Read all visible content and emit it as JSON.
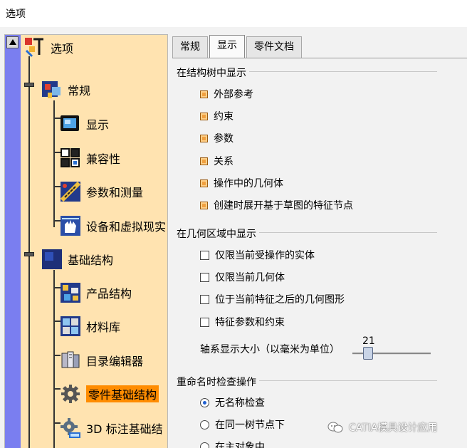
{
  "window": {
    "title": "选项"
  },
  "tree": {
    "items": [
      {
        "label": "选项",
        "icon": "options-icon"
      },
      {
        "label": "常规",
        "icon": "general-icon"
      },
      {
        "label": "显示",
        "icon": "display-icon"
      },
      {
        "label": "兼容性",
        "icon": "compatibility-icon"
      },
      {
        "label": "参数和测量",
        "icon": "parameters-measure-icon"
      },
      {
        "label": "设备和虚拟现实",
        "icon": "devices-vr-icon"
      },
      {
        "label": "基础结构",
        "icon": "infrastructure-icon"
      },
      {
        "label": "产品结构",
        "icon": "product-structure-icon"
      },
      {
        "label": "材料库",
        "icon": "material-library-icon"
      },
      {
        "label": "目录编辑器",
        "icon": "catalog-editor-icon"
      },
      {
        "label": "零件基础结构",
        "icon": "part-infrastructure-gear-icon",
        "selected": true
      },
      {
        "label": "3D 标注基础结",
        "icon": "annotation-3d-gear-icon"
      }
    ]
  },
  "tabs": [
    {
      "label": "常规",
      "active": false
    },
    {
      "label": "显示",
      "active": true
    },
    {
      "label": "零件文档",
      "active": false
    }
  ],
  "groups": {
    "tree_display": {
      "title": "在结构树中显示",
      "options": [
        {
          "label": "外部参考",
          "checked": true
        },
        {
          "label": "约束",
          "checked": true
        },
        {
          "label": "参数",
          "checked": true
        },
        {
          "label": "关系",
          "checked": true
        },
        {
          "label": "操作中的几何体",
          "checked": true
        },
        {
          "label": "创建时展开基于草图的特征节点",
          "checked": true
        }
      ]
    },
    "geometry_display": {
      "title": "在几何区域中显示",
      "options": [
        {
          "label": "仅限当前受操作的实体",
          "checked": false
        },
        {
          "label": "仅限当前几何体",
          "checked": false
        },
        {
          "label": "位于当前特征之后的几何图形",
          "checked": false
        },
        {
          "label": "特征参数和约束",
          "checked": false
        }
      ],
      "axis_size": {
        "label": "轴系显示大小（以毫米为单位）",
        "value": "21",
        "fraction": 0.15
      }
    },
    "rename_check": {
      "title": "重命名时检查操作",
      "options": [
        {
          "label": "无名称检查",
          "selected": true
        },
        {
          "label": "在同一树节点下",
          "selected": false
        },
        {
          "label": "在主对象中",
          "selected": false
        }
      ]
    }
  },
  "watermark": {
    "text": "CATIA模具设计应用",
    "icon": "wechat-icon"
  },
  "colors": {
    "tree_bg": "#ffe3b0",
    "selection": "#ff8c00",
    "scrollbar": "#7a7ef0",
    "checkbox_on": "#f0a040",
    "radio_dot": "#1f5fd0"
  }
}
